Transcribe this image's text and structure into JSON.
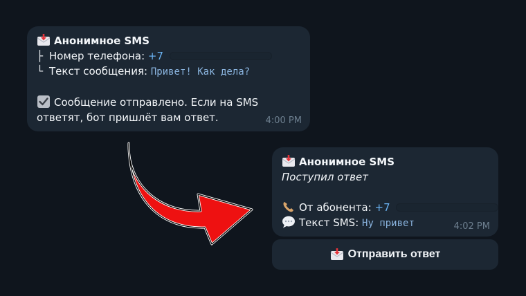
{
  "message1": {
    "title": "Анонимное SMS",
    "phone_label": "Номер телефона:",
    "phone_value": "+7",
    "text_label": "Текст сообщения:",
    "text_value": "Привет! Как дела?",
    "status_line1": "Сообщение отправлено. Если на SMS",
    "status_line2": "ответят, бот пришлёт вам ответ.",
    "time": "4:00 PM",
    "tree_branch": "├",
    "tree_end": "└"
  },
  "message2": {
    "title": "Анонимное SMS",
    "subtitle": "Поступил ответ",
    "from_label": "От абонента:",
    "from_value": "+7",
    "text_label": "Текст SMS:",
    "text_value": "Ну привет",
    "time": "4:02 PM"
  },
  "reply_button": {
    "label": "Отправить ответ"
  },
  "icons": {
    "envelope": "inbox-tray-envelope-icon",
    "check": "checkbox-check-icon",
    "phone": "telephone-icon",
    "speech": "speech-bubble-icon",
    "arrow": "red-curved-arrow"
  },
  "colors": {
    "background": "#0f151d",
    "bubble": "#1c2733",
    "link": "#6ab2f2",
    "code": "#8ab4df",
    "time": "#6d7f8f",
    "arrow": "#ee1111"
  }
}
